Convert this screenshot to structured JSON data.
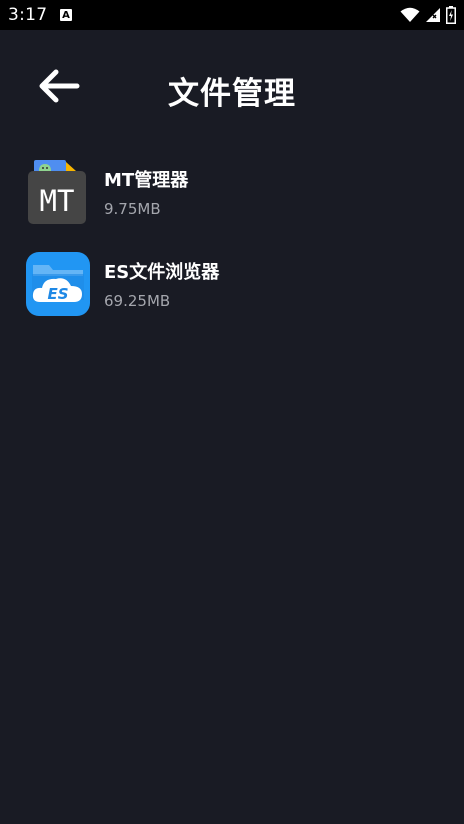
{
  "status_bar": {
    "time": "3:17",
    "notification_badge": "A",
    "icons": [
      "wifi-icon",
      "signal-icon",
      "battery-icon"
    ]
  },
  "header": {
    "back_icon": "arrow-left-icon",
    "title": "文件管理"
  },
  "apps": [
    {
      "name": "MT管理器",
      "size": "9.75MB",
      "icon": "mt-manager-app-icon"
    },
    {
      "name": "ES文件浏览器",
      "size": "69.25MB",
      "icon": "es-file-explorer-app-icon"
    }
  ],
  "colors": {
    "background": "#191b24",
    "status_bar": "#000000",
    "primary_text": "#ffffff",
    "secondary_text": "#a4a6ad",
    "es_icon_blue": "#2196f3"
  }
}
